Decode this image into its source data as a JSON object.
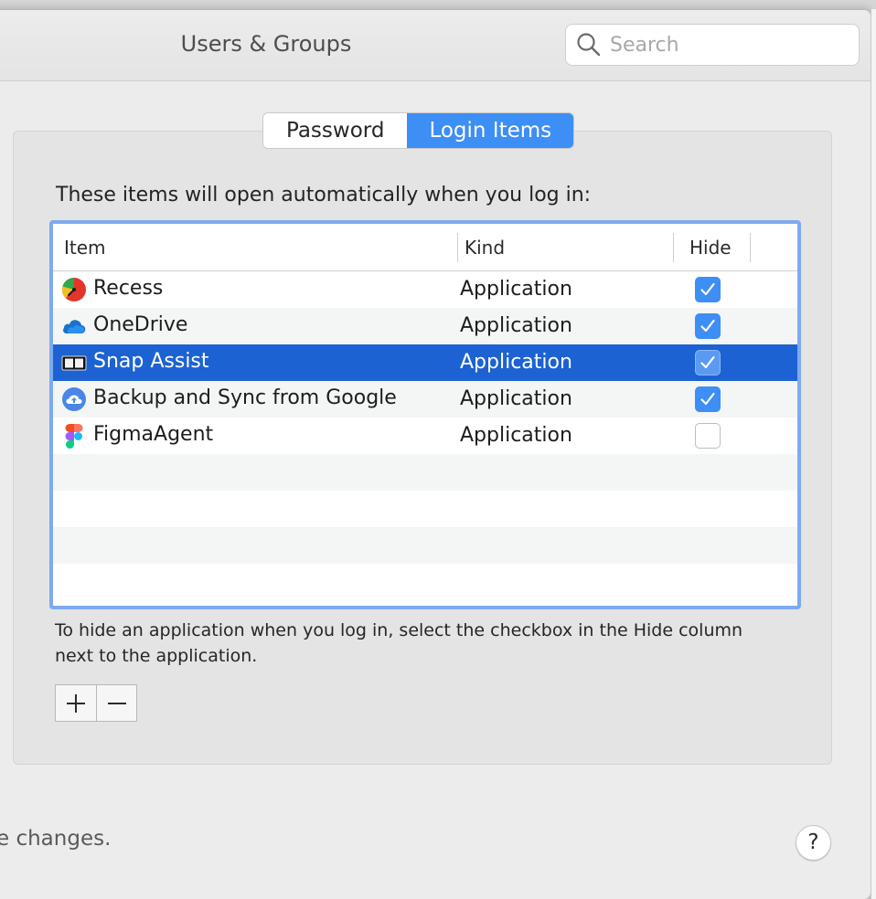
{
  "window": {
    "title": "Users & Groups"
  },
  "search": {
    "placeholder": "Search",
    "icon": "magnifier-icon"
  },
  "tabs": [
    {
      "label": "Password",
      "active": false
    },
    {
      "label": "Login Items",
      "active": true
    }
  ],
  "login_items": {
    "intro": "These items will open automatically when you log in:",
    "columns": {
      "item": "Item",
      "kind": "Kind",
      "hide": "Hide"
    },
    "rows": [
      {
        "name": "Recess",
        "kind": "Application",
        "hide": true,
        "icon": "recess-icon"
      },
      {
        "name": "OneDrive",
        "kind": "Application",
        "hide": true,
        "icon": "onedrive-icon"
      },
      {
        "name": "Snap Assist",
        "kind": "Application",
        "hide": true,
        "icon": "snap-assist-icon",
        "selected": true
      },
      {
        "name": "Backup and Sync from Google",
        "kind": "Application",
        "hide": true,
        "icon": "google-backup-icon"
      },
      {
        "name": "FigmaAgent",
        "kind": "Application",
        "hide": false,
        "icon": "figma-icon"
      }
    ],
    "help": "To hide an application when you log in, select the checkbox in the Hide column next to the application.",
    "add_label": "+",
    "remove_label": "−"
  },
  "footer": {
    "text": "e changes.",
    "help_label": "?"
  },
  "colors": {
    "accent": "#3d8ef5",
    "selection": "#1c62d3",
    "focus_ring": "#7eaaf0"
  }
}
